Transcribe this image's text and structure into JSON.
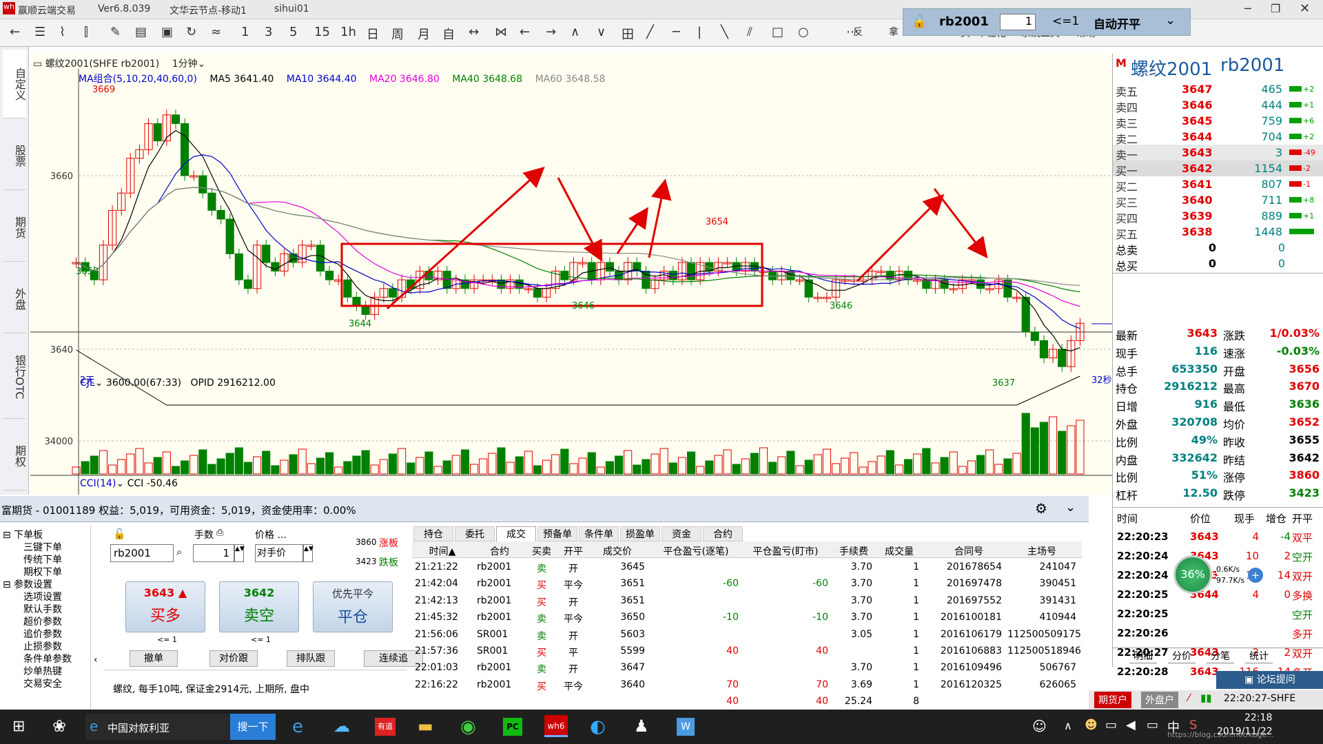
{
  "app": {
    "title": "赢顺云端交易",
    "version": "Ver6.8.039",
    "node": "文华云节点-移动1",
    "user": "sihui01"
  },
  "toolbar": {
    "items": [
      "1",
      "3",
      "5",
      "15",
      "1h",
      "日",
      "周",
      "月",
      "自",
      "↔",
      "⋈",
      "←",
      "→",
      "∧",
      "∨",
      "田",
      "╱",
      "─",
      "|",
      "╲",
      "⫽",
      "□",
      "○",
      "■",
      "⋯"
    ],
    "menu": [
      "反",
      "拿",
      "入",
      "头",
      "个性化",
      "系统工具",
      "帮助"
    ]
  },
  "order_box": {
    "symbol": "rb2001",
    "qty": "1",
    "cond": "<=1",
    "mode": "自动开平"
  },
  "left_nav": [
    "自定义",
    "股票",
    "期货",
    "外盘",
    "银行OTC",
    "期权"
  ],
  "chart": {
    "title": "螺纹2001(SHFE rb2001)",
    "period": "1分钟",
    "ma": {
      "label": "MA组合(5,10,20,40,60,0)",
      "ma5": "MA5 3641.40",
      "ma10": "MA10 3644.40",
      "ma20": "MA20 3646.80",
      "ma40": "MA40 3648.68",
      "ma60": "MA60 3648.58"
    },
    "yticks": [
      "3660",
      "3640"
    ],
    "bottom_left": "2天",
    "bottom_right": "32秒",
    "price_labels": [
      "3669",
      "3650",
      "3644",
      "3646",
      "3654",
      "3646",
      "3637"
    ],
    "vol": {
      "label": "CJL",
      "value": "3600.00(67:33)",
      "opid": "OPID 2916212.00",
      "ytick": "34000"
    },
    "cci": {
      "label": "CCI(14)",
      "value": "CCI -50.46"
    },
    "colors": {
      "up": "#e00000",
      "down": "#008000",
      "bg": "#fffef0"
    }
  },
  "quote": {
    "marker": "M",
    "name": "螺纹2001",
    "code": "rb2001",
    "asks": [
      {
        "label": "卖五",
        "price": "3647",
        "vol": "465",
        "chg": "+2"
      },
      {
        "label": "卖四",
        "price": "3646",
        "vol": "444",
        "chg": "+1"
      },
      {
        "label": "卖三",
        "price": "3645",
        "vol": "759",
        "chg": "+6"
      },
      {
        "label": "卖二",
        "price": "3644",
        "vol": "704",
        "chg": "+2"
      },
      {
        "label": "卖一",
        "price": "3643",
        "vol": "3",
        "chg": "-49"
      }
    ],
    "bids": [
      {
        "label": "买一",
        "price": "3642",
        "vol": "1154",
        "chg": "-2"
      },
      {
        "label": "买二",
        "price": "3641",
        "vol": "807",
        "chg": "-1"
      },
      {
        "label": "买三",
        "price": "3640",
        "vol": "711",
        "chg": "+8"
      },
      {
        "label": "买四",
        "price": "3639",
        "vol": "889",
        "chg": "+1"
      },
      {
        "label": "买五",
        "price": "3638",
        "vol": "1448",
        "chg": ""
      }
    ],
    "totals": [
      {
        "label": "总卖",
        "a": "0",
        "b": "0"
      },
      {
        "label": "总买",
        "a": "0",
        "b": "0"
      }
    ],
    "stats": [
      {
        "l1": "最新",
        "v1": "3643",
        "l2": "涨跌",
        "v2": "1/0.03%"
      },
      {
        "l1": "现手",
        "v1": "116",
        "l2": "速涨",
        "v2": "-0.03%"
      },
      {
        "l1": "总手",
        "v1": "653350",
        "l2": "开盘",
        "v2": "3656"
      },
      {
        "l1": "持仓",
        "v1": "2916212",
        "l2": "最高",
        "v2": "3670"
      },
      {
        "l1": "日增",
        "v1": "916",
        "l2": "最低",
        "v2": "3636"
      },
      {
        "l1": "外盘",
        "v1": "320708",
        "l2": "均价",
        "v2": "3652"
      },
      {
        "l1": "比例",
        "v1": "49%",
        "l2": "昨收",
        "v2": "3655"
      },
      {
        "l1": "内盘",
        "v1": "332642",
        "l2": "昨结",
        "v2": "3642"
      },
      {
        "l1": "比例",
        "v1": "51%",
        "l2": "涨停",
        "v2": "3860"
      },
      {
        "l1": "杠杆",
        "v1": "12.50",
        "l2": "跌停",
        "v2": "3423"
      }
    ],
    "ticks_header": [
      "时间",
      "价位",
      "现手",
      "增仓",
      "开平"
    ],
    "ticks": [
      {
        "t": "22:20:23",
        "p": "3643",
        "v": "4",
        "z": "-4",
        "k": "双平"
      },
      {
        "t": "22:20:24",
        "p": "3643",
        "v": "10",
        "z": "2",
        "k": "空开"
      },
      {
        "t": "22:20:24",
        "p": "3643",
        "v": "14",
        "z": "14",
        "k": "双开"
      },
      {
        "t": "22:20:25",
        "p": "3644",
        "v": "4",
        "z": "0",
        "k": "多换"
      },
      {
        "t": "22:20:25",
        "p": "",
        "v": "",
        "z": "",
        "k": "空开"
      },
      {
        "t": "22:20:26",
        "p": "",
        "v": "",
        "z": "",
        "k": "多开"
      },
      {
        "t": "22:20:27",
        "p": "3643",
        "v": "2",
        "z": "2",
        "k": "双开"
      },
      {
        "t": "22:20:28",
        "p": "3643",
        "v": "116",
        "z": "14",
        "k": "多开"
      }
    ],
    "tabs": [
      "明细",
      "分价",
      "分笔",
      "统计"
    ],
    "speed": {
      "pct": "36%",
      "up": "0.6K/s",
      "down": "97.7K/s"
    },
    "forum": "论坛提问"
  },
  "account": {
    "line": "富期货 - 01001189  权益：5,019，可用资金：5,019，资金使用率：0.00%"
  },
  "tree": [
    "下单板",
    "三键下单",
    "传统下单",
    "期权下单",
    "参数设置",
    "选项设置",
    "默认手数",
    "超价参数",
    "追价参数",
    "止损参数",
    "条件单参数",
    "炒单热键",
    "交易安全"
  ],
  "order_panel": {
    "symbol": "rb2001",
    "qty_label": "手数",
    "qty": "1",
    "price_label": "价格 ...",
    "price": "对手价",
    "limit_up": "3860",
    "limit_up_label": "涨板",
    "limit_down": "3423",
    "limit_down_label": "跌板",
    "buy_price": "3643",
    "buy_label": "买多",
    "sell_price": "3642",
    "sell_label": "卖空",
    "close_label": "优先平今",
    "close_btn": "平仓",
    "buy_sub": "<= 1",
    "sell_sub": "<= 1",
    "btns": [
      "撤单",
      "对价跟",
      "排队跟",
      "连续追"
    ],
    "info": "螺纹, 每手10吨, 保证金2914元, 上期所, 盘中"
  },
  "trades": {
    "tabs": [
      "持仓",
      "委托",
      "成交",
      "预备单",
      "条件单",
      "损盈单",
      "资金",
      "合约"
    ],
    "active_tab": "成交",
    "headers": [
      "时间▲",
      "合约",
      "买卖",
      "开平",
      "成交价",
      "平仓盈亏(逐笔)",
      "平仓盈亏(盯市)",
      "手续费",
      "成交量",
      "合同号",
      "主场号"
    ],
    "rows": [
      [
        "21:21:22",
        "rb2001",
        "卖",
        "开",
        "3645",
        "",
        "",
        "3.70",
        "1",
        "201678654",
        "241047"
      ],
      [
        "21:42:04",
        "rb2001",
        "买",
        "平今",
        "3651",
        "-60",
        "-60",
        "3.70",
        "1",
        "201697478",
        "390451"
      ],
      [
        "21:42:13",
        "rb2001",
        "买",
        "开",
        "3651",
        "",
        "",
        "3.70",
        "1",
        "201697552",
        "391431"
      ],
      [
        "21:45:32",
        "rb2001",
        "卖",
        "平今",
        "3650",
        "-10",
        "-10",
        "3.70",
        "1",
        "2016100181",
        "410944"
      ],
      [
        "21:56:06",
        "SR001",
        "卖",
        "开",
        "5603",
        "",
        "",
        "3.05",
        "1",
        "2016106179",
        "112500509175"
      ],
      [
        "21:57:36",
        "SR001",
        "买",
        "平",
        "5599",
        "40",
        "40",
        "",
        "1",
        "2016106883",
        "112500518946"
      ],
      [
        "22:01:03",
        "rb2001",
        "卖",
        "开",
        "3647",
        "",
        "",
        "3.70",
        "1",
        "2016109496",
        "506767"
      ],
      [
        "22:16:22",
        "rb2001",
        "买",
        "平今",
        "3640",
        "70",
        "70",
        "3.69",
        "1",
        "2016120325",
        "626065"
      ]
    ],
    "total": [
      "40",
      "40",
      "25.24",
      "8"
    ]
  },
  "status": {
    "btn1": "期货户",
    "btn2": "外盘户",
    "time": "22:20:27-SHFE"
  },
  "taskbar": {
    "search": "中国对叙利亚",
    "search_btn": "搜一下",
    "clock": "22:18",
    "date": "2019/11/22",
    "lang": "中",
    "url": "https://blog.csdn.net/kuge..."
  }
}
